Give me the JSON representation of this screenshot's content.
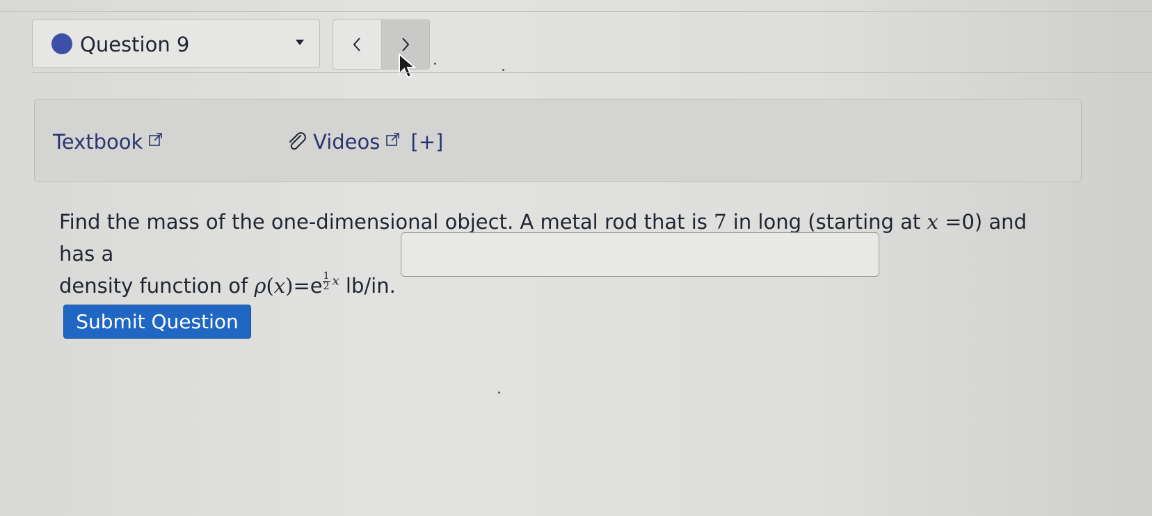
{
  "header": {
    "question_select": {
      "label": "Question 9",
      "status_color": "#3d50a8"
    },
    "nav": {
      "prev_icon": "chevron-left-icon",
      "next_icon": "chevron-right-icon"
    }
  },
  "resources": {
    "textbook_label": "Textbook",
    "videos_label": "Videos",
    "expand_label": "[+]"
  },
  "question": {
    "text_part1": "Find the mass of the one-dimensional object. A metal rod that is ",
    "rod_length": "7",
    "text_part2": " in long (starting at ",
    "var_x": "x",
    "text_part3": " =0) and has a",
    "text_part4": "density function of ",
    "rho": "ρ",
    "paren_open": "(",
    "paren_close": ")",
    "equals_e": "=e",
    "frac_num": "1",
    "frac_den": "2",
    "units": " lb/in.",
    "answer_value": ""
  },
  "actions": {
    "submit_label": "Submit Question",
    "submit_color": "#2067c4"
  }
}
